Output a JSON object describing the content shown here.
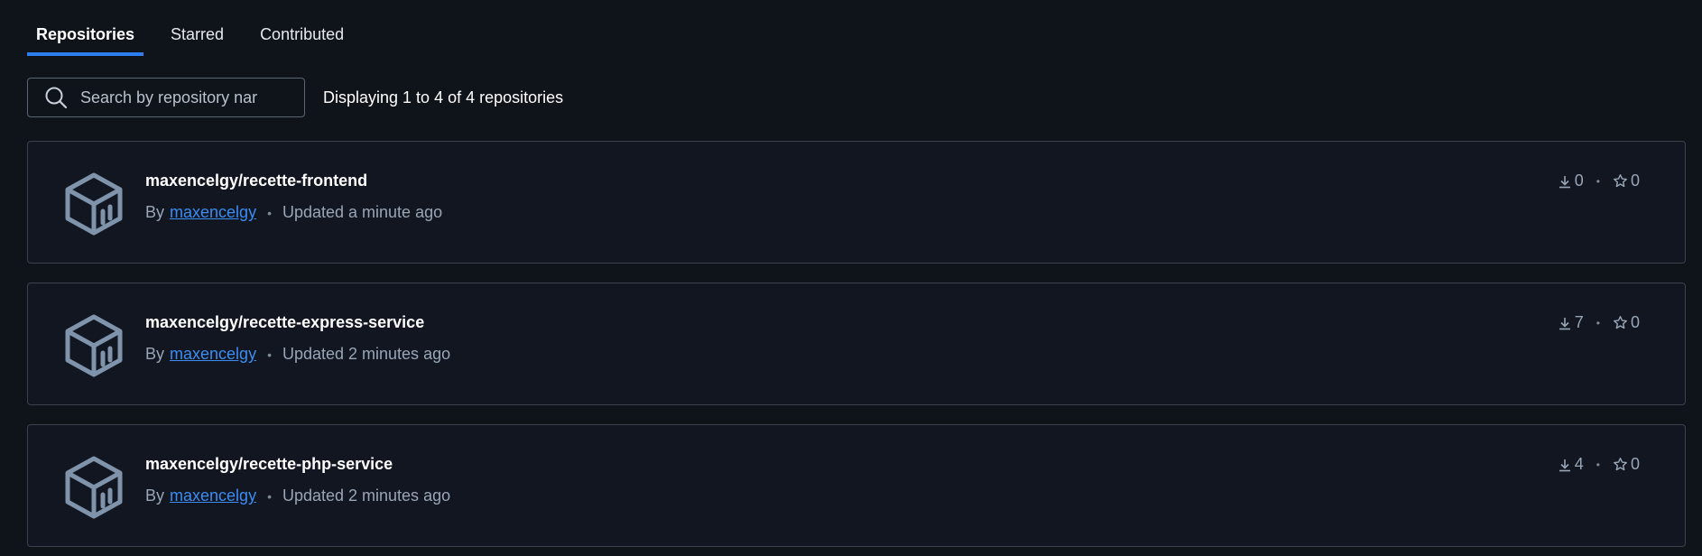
{
  "tabs": [
    {
      "label": "Repositories",
      "active": true
    },
    {
      "label": "Starred",
      "active": false
    },
    {
      "label": "Contributed",
      "active": false
    }
  ],
  "search": {
    "placeholder": "Search by repository nar",
    "value": ""
  },
  "display_count": "Displaying 1 to 4 of 4 repositories",
  "repositories": [
    {
      "name": "maxencelgy/recette-frontend",
      "by_label": "By",
      "author": "maxencelgy",
      "updated": "Updated a minute ago",
      "downloads": "0",
      "stars": "0"
    },
    {
      "name": "maxencelgy/recette-express-service",
      "by_label": "By",
      "author": "maxencelgy",
      "updated": "Updated 2 minutes ago",
      "downloads": "7",
      "stars": "0"
    },
    {
      "name": "maxencelgy/recette-php-service",
      "by_label": "By",
      "author": "maxencelgy",
      "updated": "Updated 2 minutes ago",
      "downloads": "4",
      "stars": "0"
    }
  ],
  "icons": {
    "search": "search-icon",
    "repo": "cube-icon",
    "downloads": "download-icon",
    "stars": "star-icon"
  },
  "colors": {
    "accent": "#2d7ff0",
    "background": "#0f131a",
    "link": "#3b8cf3"
  }
}
